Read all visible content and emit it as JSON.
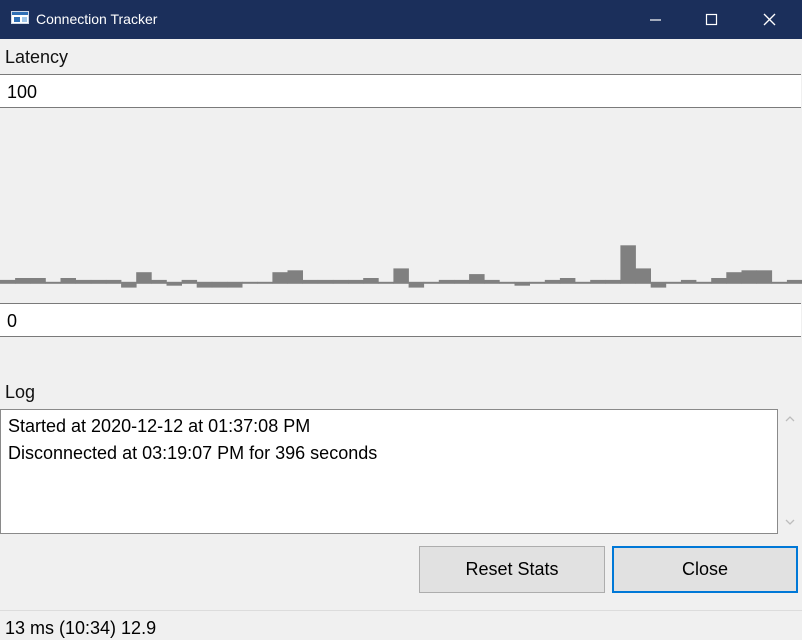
{
  "window": {
    "title": "Connection Tracker",
    "icon": "app-window-icon",
    "controls": [
      "minimize-icon",
      "maximize-icon",
      "close-icon"
    ]
  },
  "latency": {
    "label": "Latency",
    "max_value": "100",
    "min_value": "0"
  },
  "graph": {
    "bar_color": "#808080",
    "samples_ms": [
      11,
      12,
      12,
      10,
      12,
      11,
      11,
      11,
      8,
      15,
      11,
      9,
      11,
      8,
      8,
      8,
      10,
      10,
      15,
      16,
      11,
      11,
      11,
      11,
      12,
      10,
      17,
      8,
      10,
      11,
      11,
      14,
      11,
      10,
      9,
      10,
      11,
      12,
      10,
      11,
      11,
      29,
      17,
      8,
      10,
      11,
      10,
      12,
      15,
      16,
      16,
      10,
      11
    ]
  },
  "log": {
    "label": "Log",
    "lines": [
      "Started at 2020-12-12 at 01:37:08 PM",
      "Disconnected at 03:19:07 PM for 396 seconds"
    ]
  },
  "buttons": {
    "reset": "Reset Stats",
    "close": "Close"
  },
  "status": {
    "text": "13 ms (10:34) 12.9"
  },
  "colors": {
    "titlebar": "#1b2f5b",
    "focus_border": "#0078d7"
  }
}
